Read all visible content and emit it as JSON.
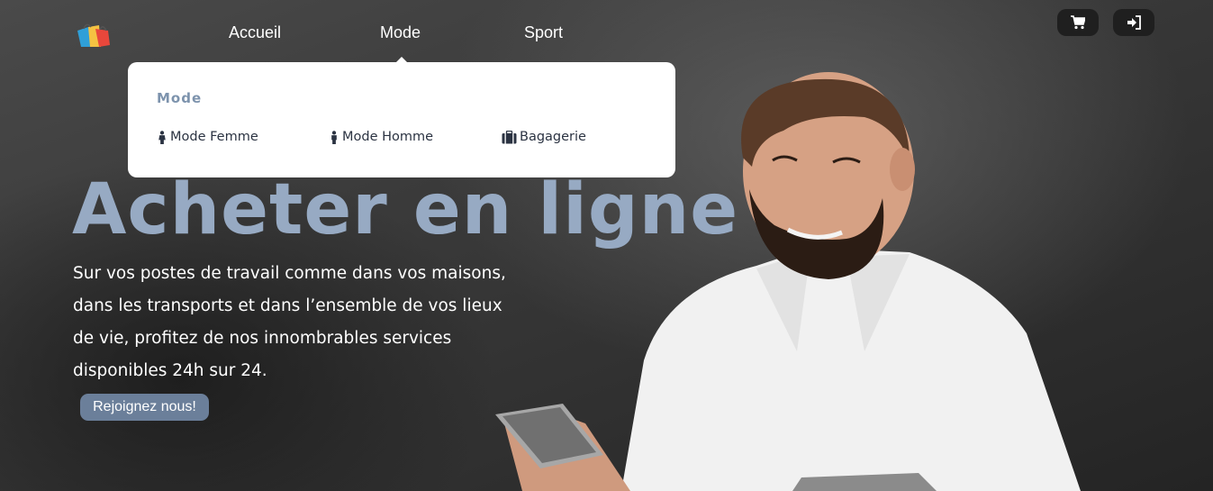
{
  "nav": {
    "links": [
      "Accueil",
      "Mode",
      "Sport"
    ],
    "icons": [
      "cart-icon",
      "sign-in-icon"
    ]
  },
  "dropdown": {
    "title": "Mode",
    "items": [
      {
        "label": "Mode Femme",
        "icon": "female-icon"
      },
      {
        "label": "Mode Homme",
        "icon": "male-icon"
      },
      {
        "label": "Bagagerie",
        "icon": "suitcase-icon"
      }
    ]
  },
  "hero": {
    "title": "Acheter en ligne",
    "description": "Sur vos postes de travail comme dans vos maisons, dans les transports et dans l’ensemble de vos lieux de vie, profitez de nos innombrables services disponibles 24h sur 24.",
    "cta": "Rejoignez nous!"
  },
  "colors": {
    "accent": "#97aac3",
    "button": "#6b7f9a",
    "dropdown_title": "#7d93ad"
  }
}
